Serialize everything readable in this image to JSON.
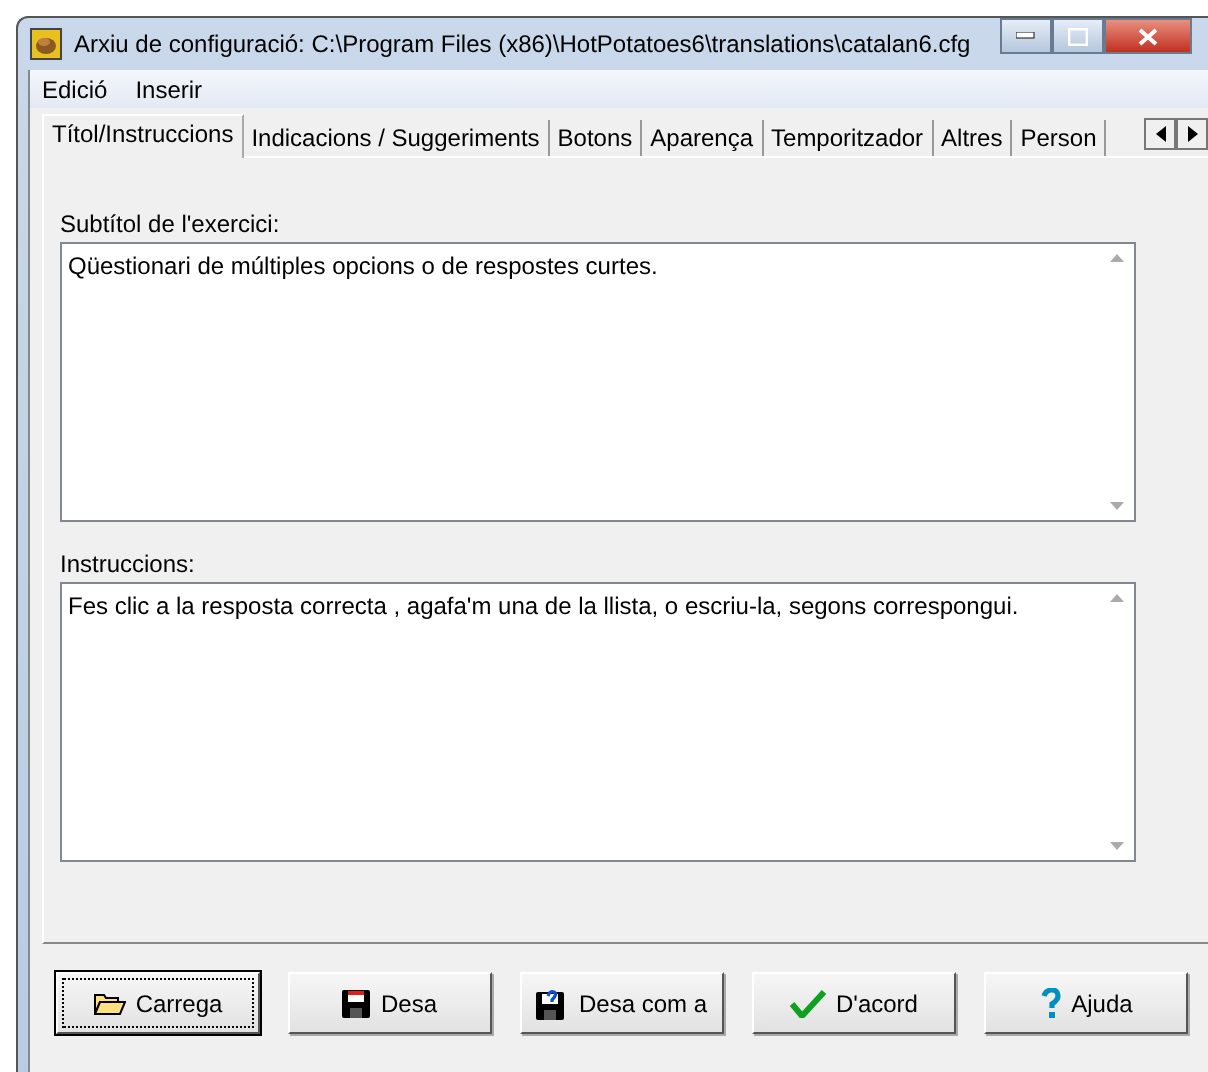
{
  "window": {
    "title": "Arxiu de configuració: C:\\Program Files (x86)\\HotPotatoes6\\translations\\catalan6.cfg"
  },
  "menu": [
    {
      "label": "Edició"
    },
    {
      "label": "Inserir"
    }
  ],
  "tabs": [
    {
      "label": "Títol/Instruccions",
      "selected": true
    },
    {
      "label": "Indicacions / Suggeriments",
      "selected": false
    },
    {
      "label": "Botons",
      "selected": false
    },
    {
      "label": "Aparença",
      "selected": false
    },
    {
      "label": "Temporitzador",
      "selected": false
    },
    {
      "label": "Altres",
      "selected": false
    },
    {
      "label": "Person",
      "selected": false
    }
  ],
  "fields": [
    {
      "label": "Subtítol de l'exercici:",
      "value": "Qüestionari de múltiples opcions o de respostes curtes."
    },
    {
      "label": "Instruccions:",
      "value": "Fes clic a la resposta correcta , agafa'm una de la llista, o escriu-la, segons correspongui."
    }
  ],
  "buttons": [
    {
      "kind": "open",
      "label": "Carrega",
      "focused": true
    },
    {
      "kind": "save",
      "label": "Desa",
      "focused": false
    },
    {
      "kind": "saveas",
      "label": "Desa com a",
      "focused": false
    },
    {
      "kind": "ok",
      "label": "D'acord",
      "focused": false
    },
    {
      "kind": "help",
      "label": "Ajuda",
      "focused": false
    }
  ]
}
